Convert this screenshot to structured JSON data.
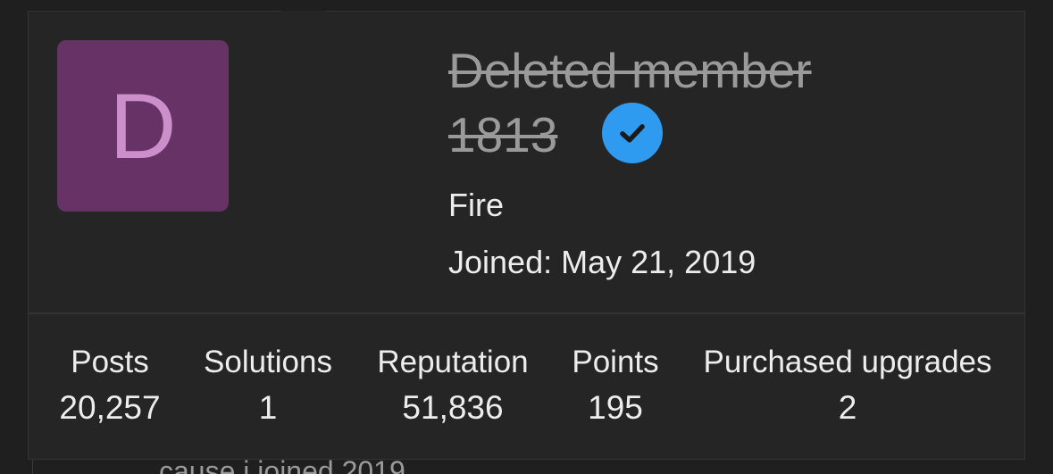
{
  "profile": {
    "avatar_letter": "D",
    "username_line1": "Deleted member",
    "username_line2": "1813",
    "title": "Fire",
    "joined_label": "Joined:",
    "joined_date": "May 21, 2019",
    "verified": true
  },
  "stats": [
    {
      "label": "Posts",
      "value": "20,257"
    },
    {
      "label": "Solutions",
      "value": "1"
    },
    {
      "label": "Reputation",
      "value": "51,836"
    },
    {
      "label": "Points",
      "value": "195"
    },
    {
      "label": "Purchased upgrades",
      "value": "2"
    }
  ],
  "background": {
    "partial_text": "cause i joined 2019"
  },
  "colors": {
    "card_bg": "#252526",
    "avatar_bg": "#673366",
    "avatar_letter": "#cc8fcb",
    "verified_badge": "#2f9bf0",
    "text": "#ededed",
    "muted": "#9a9a9a"
  },
  "icons": {
    "verified": "checkmark-badge-icon"
  }
}
